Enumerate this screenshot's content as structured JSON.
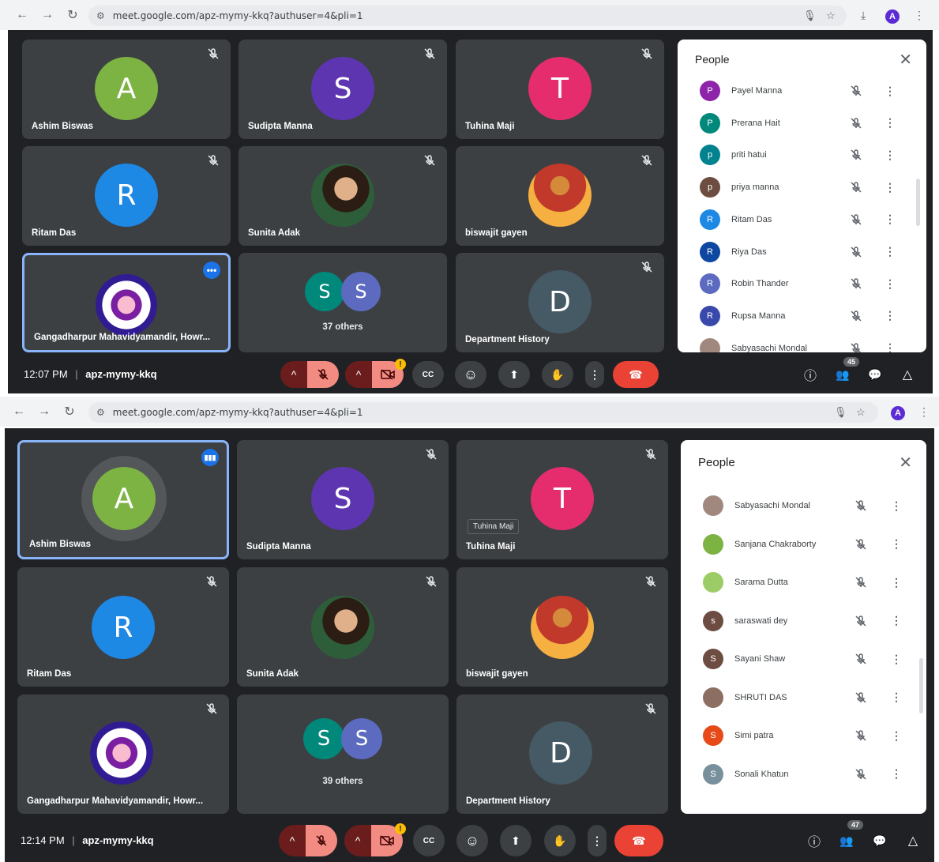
{
  "screenshots": [
    {
      "browser": {
        "url": "meet.google.com/apz-mymy-kkq?authuser=4&pli=1",
        "profile_initial": "A"
      },
      "tiles": [
        {
          "name": "Ashim Biswas",
          "initial": "A",
          "color": "#7cb342",
          "type": "avatar",
          "muted": true
        },
        {
          "name": "Sudipta Manna",
          "initial": "S",
          "color": "#5e35b1",
          "type": "avatar",
          "muted": true
        },
        {
          "name": "Tuhina Maji",
          "initial": "T",
          "color": "#e52d6e",
          "type": "avatar",
          "muted": true
        },
        {
          "name": "Ritam Das",
          "initial": "R",
          "color": "#1e88e5",
          "type": "avatar",
          "muted": true
        },
        {
          "name": "Sunita Adak",
          "type": "photo",
          "muted": true
        },
        {
          "name": "biswajit gayen",
          "type": "photo",
          "muted": true
        },
        {
          "name": "Gangadharpur Mahavidyamandir, Howr...",
          "type": "logo",
          "active": true,
          "more": "•••"
        },
        {
          "others": "37 others",
          "type": "group"
        },
        {
          "name": "Department History",
          "initial": "D",
          "color": "#455a64",
          "type": "avatar",
          "muted": true
        }
      ],
      "people_panel": {
        "title": "People",
        "close": "✕",
        "rows": [
          {
            "name": "Payel Manna",
            "initial": "P",
            "color": "#8e24aa"
          },
          {
            "name": "Prerana Hait",
            "initial": "P",
            "color": "#00897b"
          },
          {
            "name": "priti hatui",
            "initial": "p",
            "color": "#00838f"
          },
          {
            "name": "priya manna",
            "initial": "p",
            "color": "#6d4c41"
          },
          {
            "name": "Ritam Das",
            "initial": "R",
            "color": "#1e88e5"
          },
          {
            "name": "Riya Das",
            "initial": "R",
            "color": "#0d47a1"
          },
          {
            "name": "Robin Thander",
            "initial": "R",
            "color": "#5c6bc0"
          },
          {
            "name": "Rupsa Manna",
            "initial": "R",
            "color": "#3949ab"
          },
          {
            "name": "Sabyasachi Mondal",
            "initial": "",
            "color": "#a1887f"
          }
        ]
      },
      "controls": {
        "time": "12:07 PM",
        "separator": "|",
        "meeting_code": "apz-mymy-kkq",
        "people_count": "45",
        "warn": "!"
      }
    },
    {
      "browser": {
        "url": "meet.google.com/apz-mymy-kkq?authuser=4&pli=1",
        "profile_initial": "A"
      },
      "tiles": [
        {
          "name": "Ashim Biswas",
          "initial": "A",
          "color": "#7cb342",
          "type": "avatar",
          "active": true,
          "speaking": true
        },
        {
          "name": "Sudipta Manna",
          "initial": "S",
          "color": "#5e35b1",
          "type": "avatar",
          "muted": true
        },
        {
          "name": "Tuhina Maji",
          "initial": "T",
          "color": "#e52d6e",
          "type": "avatar",
          "muted": true,
          "tooltip": "Tuhina Maji"
        },
        {
          "name": "Ritam Das",
          "initial": "R",
          "color": "#1e88e5",
          "type": "avatar",
          "muted": true
        },
        {
          "name": "Sunita Adak",
          "type": "photo",
          "muted": true
        },
        {
          "name": "biswajit gayen",
          "type": "photo",
          "muted": true
        },
        {
          "name": "Gangadharpur Mahavidyamandir, Howr...",
          "type": "logo",
          "muted": true
        },
        {
          "others": "39 others",
          "type": "group"
        },
        {
          "name": "Department History",
          "initial": "D",
          "color": "#455a64",
          "type": "avatar",
          "muted": true
        }
      ],
      "people_panel": {
        "title": "People",
        "close": "✕",
        "rows": [
          {
            "name": "Sabyasachi Mondal",
            "initial": "",
            "color": "#a1887f"
          },
          {
            "name": "Sanjana Chakraborty",
            "initial": "",
            "color": "#7cb342"
          },
          {
            "name": "Sarama Dutta",
            "initial": "",
            "color": "#9ccc65"
          },
          {
            "name": "saraswati dey",
            "initial": "s",
            "color": "#6d4c41"
          },
          {
            "name": "Sayani Shaw",
            "initial": "S",
            "color": "#6d4c41"
          },
          {
            "name": "SHRUTI DAS",
            "initial": "",
            "color": "#8d6e63"
          },
          {
            "name": "Simi patra",
            "initial": "S",
            "color": "#e64a19"
          },
          {
            "name": "Sonali Khatun",
            "initial": "S",
            "color": "#78909c"
          }
        ]
      },
      "controls": {
        "time": "12:14 PM",
        "separator": "|",
        "meeting_code": "apz-mymy-kkq",
        "people_count": "47",
        "warn": "!"
      }
    }
  ],
  "icons": {
    "back": "←",
    "forward": "→",
    "reload": "↻",
    "tune": "⚙",
    "mic": "🎙",
    "star": "☆",
    "download": "⤓",
    "kebab": "⋮",
    "chevron_up": "^",
    "cc": "CC",
    "emoji": "☺",
    "present": "⬆",
    "hand": "✋",
    "more": "⋮",
    "end": "☎",
    "info": "ⓘ",
    "people": "👥",
    "chat": "💬",
    "activities": "△"
  }
}
